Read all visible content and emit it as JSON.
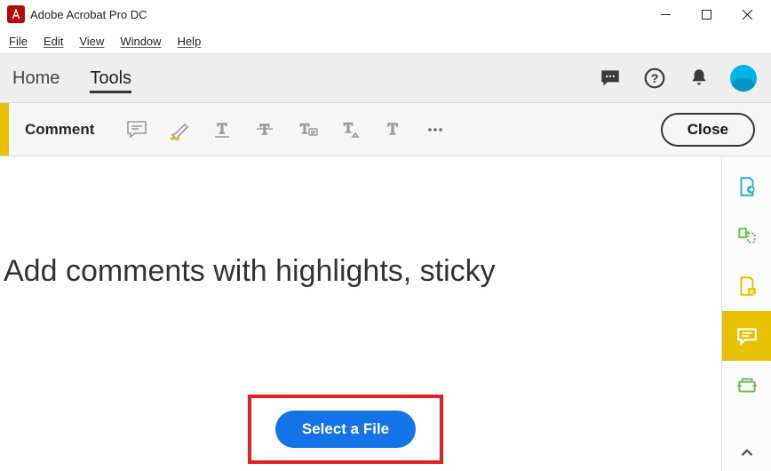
{
  "titlebar": {
    "title": "Adobe Acrobat Pro DC"
  },
  "menubar": {
    "file": "File",
    "edit": "Edit",
    "view": "View",
    "window": "Window",
    "help": "Help"
  },
  "tabs": {
    "home": "Home",
    "tools": "Tools"
  },
  "toolbar": {
    "label": "Comment",
    "close": "Close"
  },
  "main": {
    "headline": "Add comments with highlights, sticky",
    "select_file": "Select a File"
  }
}
